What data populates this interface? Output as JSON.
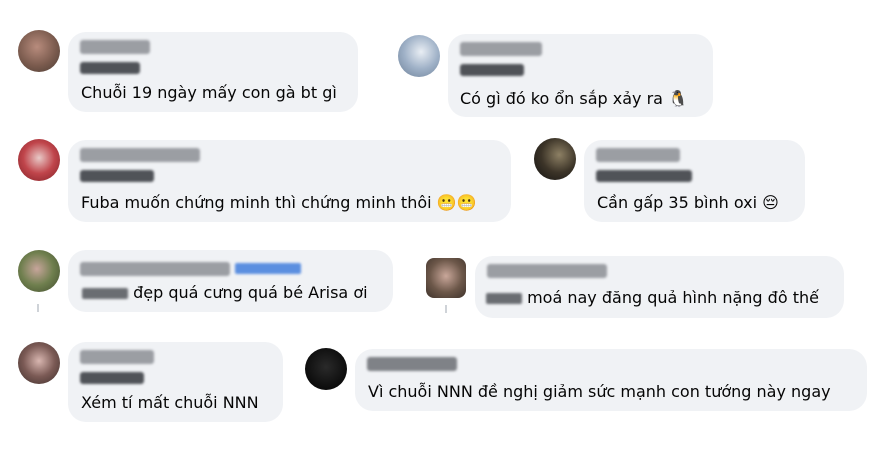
{
  "comments": [
    {
      "text": "Chuỗi 19 ngày mấy con gà bt gì",
      "avatar_color": "#8a6a5c"
    },
    {
      "text": "Có gì đó ko ổn sắp xảy ra",
      "emoji": "🐧",
      "avatar_color": "#a9b7c9"
    },
    {
      "text": "Fuba muốn chứng minh thì chứng minh thôi",
      "emoji": "😬😬",
      "avatar_color": "#b83a3f"
    },
    {
      "text": "Cần gấp 35 bình oxi",
      "emoji": "😔",
      "avatar_color": "#2f2a22"
    },
    {
      "text": "đẹp quá cưng quá bé Arisa ơi",
      "avatar_color": "#6f7f4e"
    },
    {
      "text": "moá nay đăng quả hình nặng đô thế",
      "avatar_color": "#5f4c41"
    },
    {
      "text": "Xém tí mất chuỗi NNN",
      "avatar_color": "#7b5a55"
    },
    {
      "text": "Vì chuỗi NNN đề nghị giảm sức mạnh con tướng này ngay",
      "avatar_color": "#141414"
    }
  ]
}
